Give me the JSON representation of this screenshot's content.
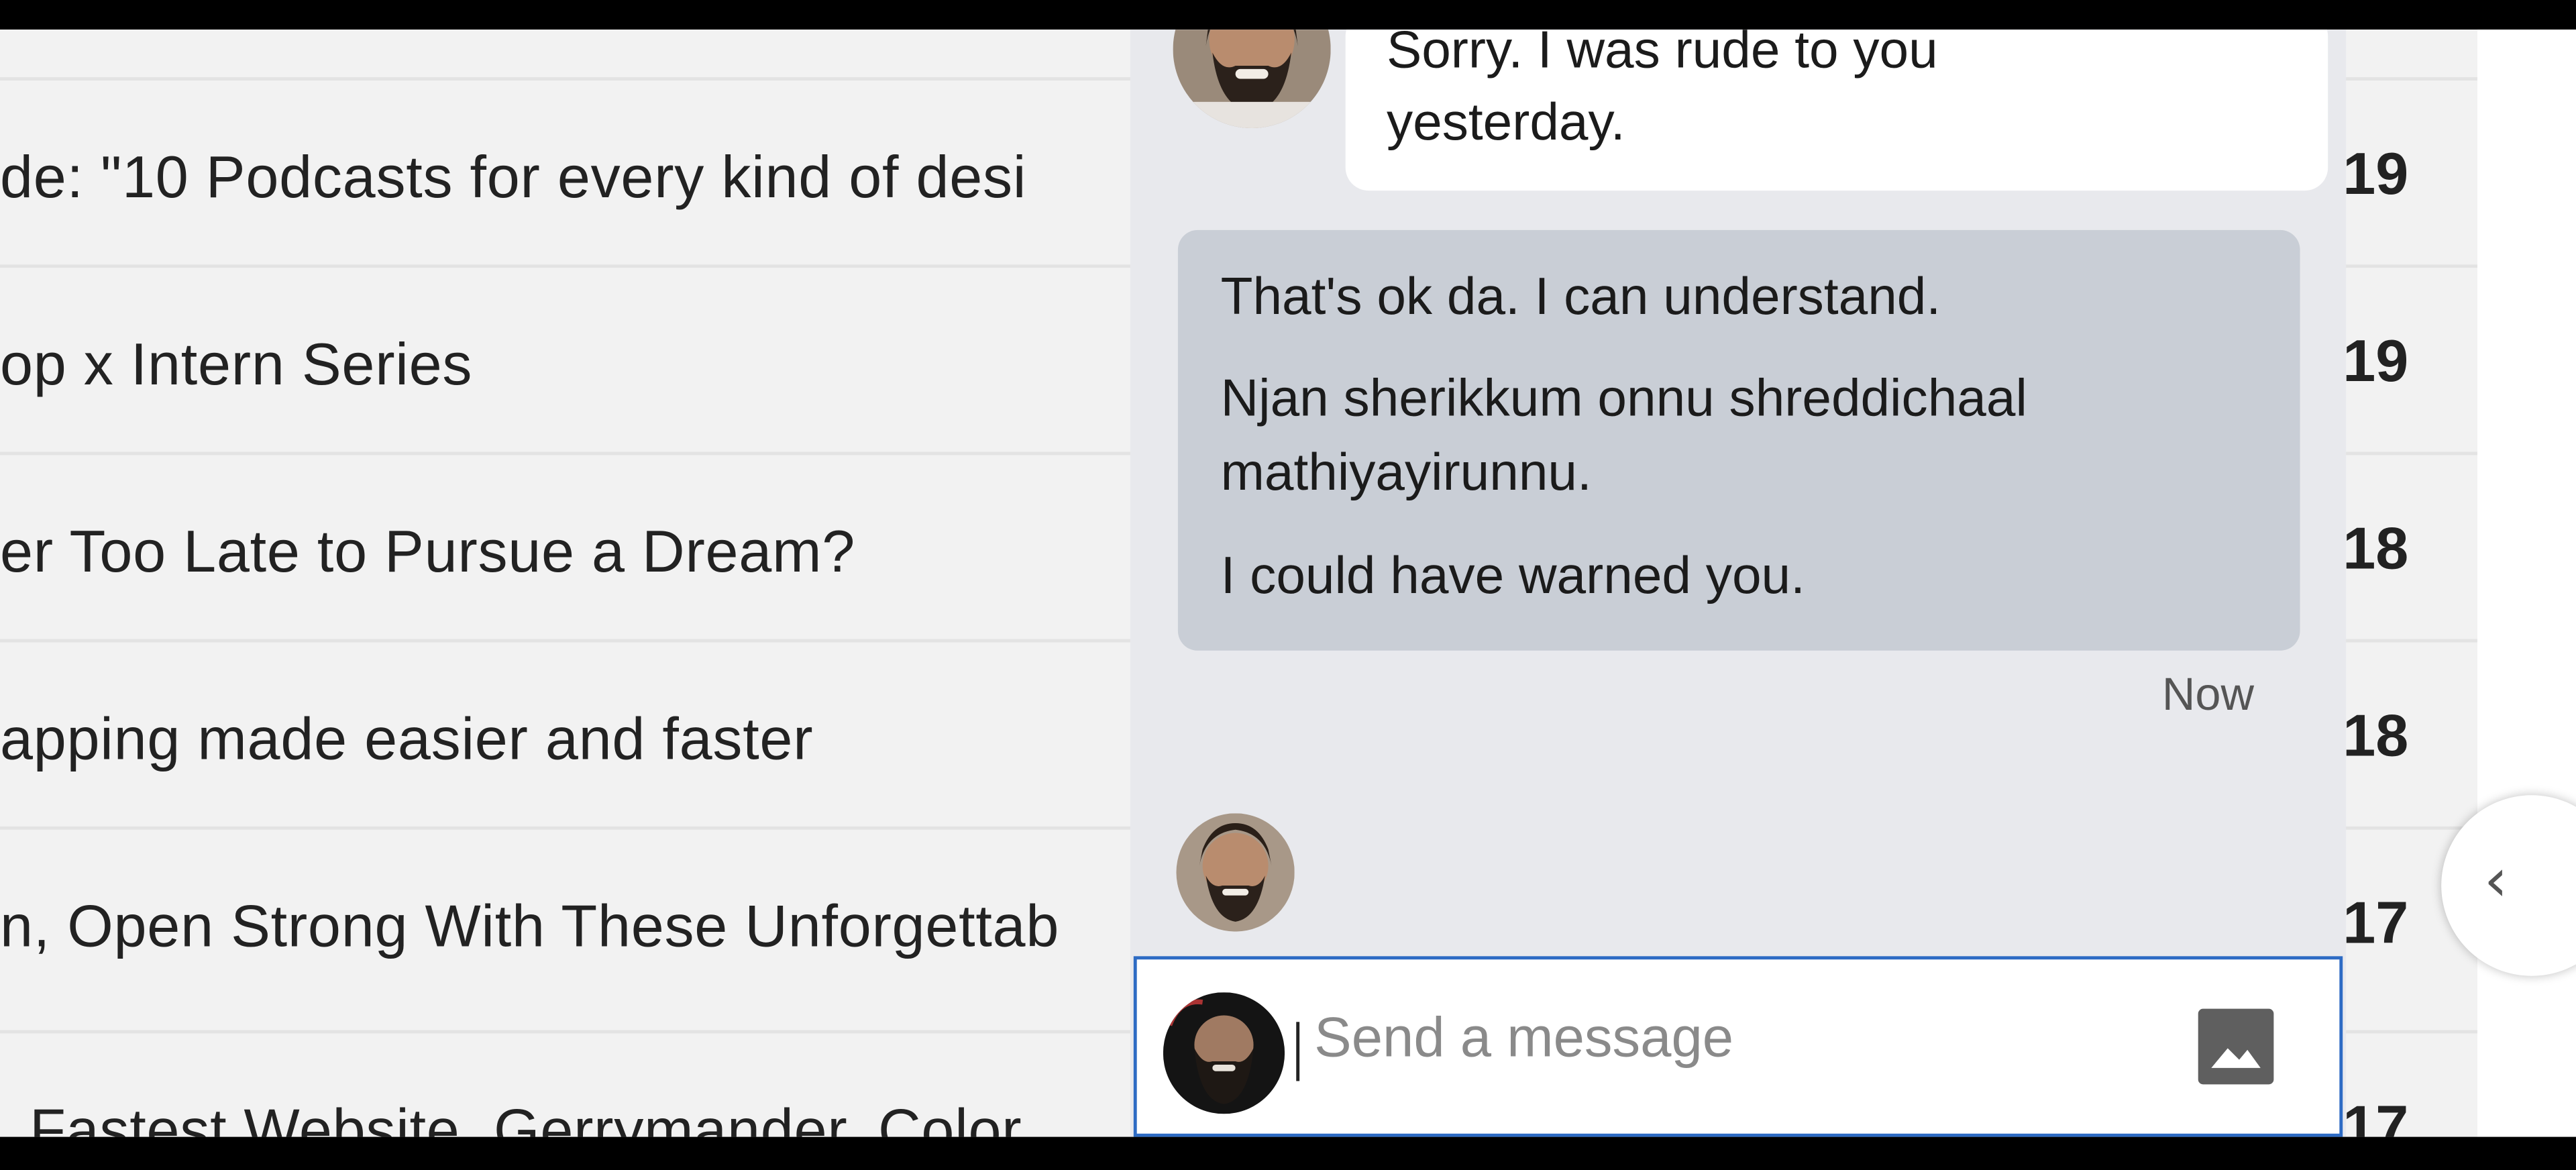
{
  "list": {
    "rows": [
      {
        "title": "",
        "date": ""
      },
      {
        "title": "de: \"10 Podcasts for every kind of desi",
        "date": "19"
      },
      {
        "title": "op x Intern Series",
        "date": "19"
      },
      {
        "title": "er Too Late to Pursue a Dream?",
        "date": "18"
      },
      {
        "title": "apping made easier and faster",
        "date": "18"
      },
      {
        "title": "n, Open Strong With These Unforgettab",
        "date": "17"
      },
      {
        "title": "Fastest Website, Gerrymander, Color",
        "date": "17"
      }
    ]
  },
  "chat": {
    "incoming": {
      "text_line1": "Sorry. I was rude to you",
      "text_line2": "yesterday."
    },
    "outgoing": {
      "line1": "That's ok da. I can understand.",
      "line2a": "Njan sherikkum onnu shreddichaal",
      "line2b": "mathiyayirunnu.",
      "line3": "I could have warned you."
    },
    "timestamp": "Now",
    "compose": {
      "placeholder": "Send a message",
      "value": ""
    }
  },
  "icons": {
    "image_button": "image-icon",
    "collapse_button": "chevron-left-icon"
  },
  "colors": {
    "accent": "#2d6bc4",
    "chat_background": "#e8e9ed",
    "outgoing_bubble": "#c9ced6",
    "incoming_bubble": "#ffffff"
  }
}
